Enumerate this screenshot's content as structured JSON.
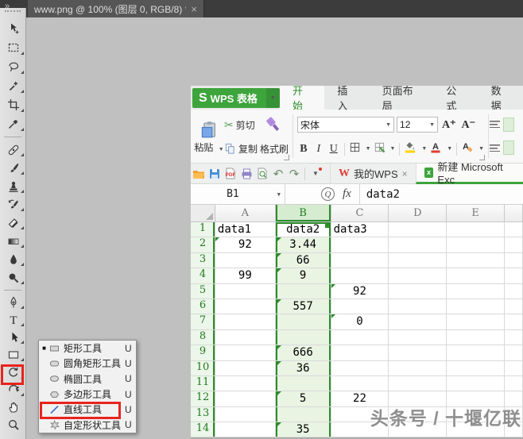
{
  "photoshop": {
    "tab": {
      "title": "www.png @ 100% (图层 0, RGB/8) *",
      "close": "×"
    },
    "tools": [
      "move",
      "rectangular-marquee",
      "lasso",
      "magic-wand",
      "crop",
      "eyedropper",
      "spot-healing-brush",
      "brush",
      "clone-stamp",
      "history-brush",
      "eraser",
      "gradient",
      "blur",
      "dodge",
      "pen",
      "type",
      "path-selection",
      "rectangle-shape",
      "rotate-3d",
      "rotate-view",
      "hand",
      "zoom"
    ],
    "flyout": {
      "items": [
        {
          "label": "矩形工具",
          "shortcut": "U",
          "selected": "■",
          "icon": "rectangle-icon"
        },
        {
          "label": "圆角矩形工具",
          "shortcut": "U",
          "icon": "rounded-rectangle-icon"
        },
        {
          "label": "椭圆工具",
          "shortcut": "U",
          "icon": "ellipse-icon"
        },
        {
          "label": "多边形工具",
          "shortcut": "U",
          "icon": "polygon-icon"
        },
        {
          "label": "直线工具",
          "shortcut": "U",
          "highlighted": true,
          "icon": "line-icon"
        },
        {
          "label": "自定形状工具",
          "shortcut": "U",
          "icon": "custom-shape-icon"
        }
      ]
    },
    "highlight_color": "#e8241d",
    "panel_collapse": "»"
  },
  "wps": {
    "app_button": {
      "logo": "S",
      "label": "WPS 表格",
      "arrow": "▼"
    },
    "ribbon_tabs": [
      {
        "label": "开始",
        "active": true
      },
      {
        "label": "插入"
      },
      {
        "label": "页面布局"
      },
      {
        "label": "公式"
      },
      {
        "label": "数据"
      }
    ],
    "ribbon": {
      "paste": "粘贴",
      "cut": "剪切",
      "copy": "复制",
      "format_painter": "格式刷",
      "font_name": "宋体",
      "font_size": "12",
      "grow_font": "A⁺",
      "shrink_font": "A⁻",
      "bold": "B",
      "italic": "I",
      "underline": "U",
      "clear_format": "A",
      "font_color": "A",
      "dropdown": "▼"
    },
    "quickbar_icons": [
      "open",
      "save",
      "export-pdf",
      "print",
      "print-preview",
      "undo",
      "redo",
      "customize-toolbar"
    ],
    "undo_glyph": "↶",
    "redo_glyph": "↷",
    "doc_tabs": [
      {
        "label": "我的WPS",
        "close": "×"
      },
      {
        "label": "新建 Microsoft Exc",
        "active": true
      }
    ],
    "formula_bar": {
      "cell_ref": "B1",
      "search_glyph": "Q",
      "fx_label": "fx",
      "value": "data2"
    },
    "grid": {
      "columns": [
        "A",
        "B",
        "C",
        "D",
        "E"
      ],
      "selected_column": "B",
      "active_cell": "B1",
      "row_count": 14,
      "cells": {
        "A1": "data1",
        "B1": "data2",
        "C1": "data3",
        "A2": "92",
        "B2": "3.44",
        "B3": "66",
        "A4": "99",
        "B4": "9",
        "C5": "92",
        "B6": "557",
        "C7": "0",
        "B9": "666",
        "B10": "36",
        "B12": "5",
        "C12": "22",
        "B14": "35"
      },
      "error_marker_cells": [
        "A2",
        "B2",
        "B3",
        "B4",
        "B6",
        "B9",
        "B10",
        "B12",
        "B14",
        "C5",
        "C7"
      ],
      "left_aligned_cells": [
        "A1",
        "C1"
      ]
    },
    "colors": {
      "brand_green": "#3ea43c",
      "selection_border": "#2c8c2b",
      "selection_fill": "#e9f4e3"
    }
  },
  "watermark": {
    "text": "头条号 / 十堰亿联"
  }
}
